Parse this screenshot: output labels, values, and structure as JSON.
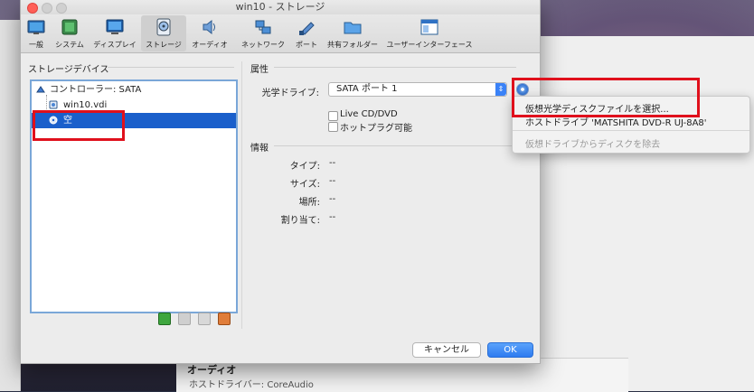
{
  "window_title": "win10 - ストレージ",
  "toolbar": {
    "items": [
      {
        "label": "一般",
        "icon": "general-icon"
      },
      {
        "label": "システム",
        "icon": "system-icon"
      },
      {
        "label": "ディスプレイ",
        "icon": "display-icon"
      },
      {
        "label": "ストレージ",
        "icon": "storage-icon"
      },
      {
        "label": "オーディオ",
        "icon": "audio-icon"
      },
      {
        "label": "ネットワーク",
        "icon": "network-icon"
      },
      {
        "label": "ポート",
        "icon": "port-icon"
      },
      {
        "label": "共有フォルダー",
        "icon": "shared-folder-icon"
      },
      {
        "label": "ユーザーインターフェース",
        "icon": "user-interface-icon"
      }
    ],
    "active": "ストレージ"
  },
  "storage_devices": {
    "title": "ストレージデバイス",
    "tree": [
      {
        "label": "コントローラー: SATA",
        "type": "controller"
      },
      {
        "label": "win10.vdi",
        "type": "disk"
      },
      {
        "label": "空",
        "type": "optical",
        "selected": true
      }
    ]
  },
  "attributes": {
    "title": "属性",
    "optical_drive_label": "光学ドライブ:",
    "optical_drive_value": "SATA ポート 1",
    "live_cd_label": "Live CD/DVD",
    "hotplug_label": "ホットプラグ可能"
  },
  "info": {
    "title": "情報",
    "rows": [
      {
        "label": "タイプ:",
        "value": "--"
      },
      {
        "label": "サイズ:",
        "value": "--"
      },
      {
        "label": "場所:",
        "value": "--"
      },
      {
        "label": "割り当て:",
        "value": "--"
      }
    ]
  },
  "menu": {
    "items": [
      {
        "label": "仮想光学ディスクファイルを選択...",
        "enabled": true
      },
      {
        "label": "ホストドライブ 'MATSHITA DVD-R   UJ-8A8'",
        "enabled": true
      },
      {
        "label": "仮想ドライブからディスクを除去",
        "enabled": false
      }
    ]
  },
  "buttons": {
    "cancel": "キャンセル",
    "ok": "OK"
  },
  "background_window": {
    "audio_label": "オーディオ",
    "host_text": "ホストドライバー: CoreAudio"
  },
  "colors": {
    "selection": "#1a5fcb",
    "accent": "#2e7bf0",
    "highlight_box": "#e0101c"
  }
}
